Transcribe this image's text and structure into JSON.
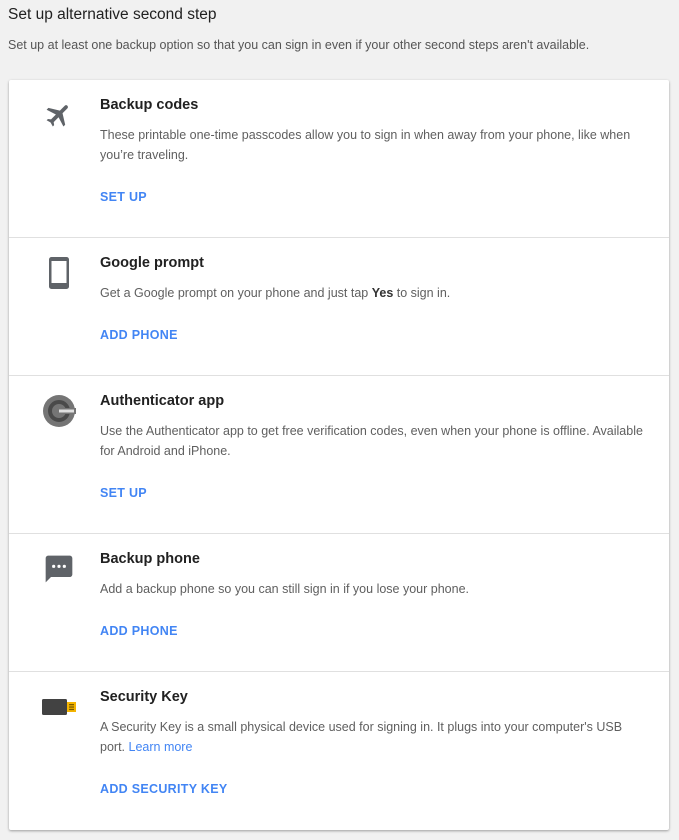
{
  "header": {
    "title": "Set up alternative second step",
    "subtitle": "Set up at least one backup option so that you can sign in even if your other second steps aren't available."
  },
  "options": [
    {
      "icon": "airplane-icon",
      "title": "Backup codes",
      "description": "These printable one-time passcodes allow you to sign in when away from your phone, like when you’re traveling.",
      "action": "SET UP"
    },
    {
      "icon": "phone-icon",
      "title": "Google prompt",
      "description_before": "Get a Google prompt on your phone and just tap ",
      "description_bold": "Yes",
      "description_after": " to sign in.",
      "action": "ADD PHONE"
    },
    {
      "icon": "authenticator-icon",
      "title": "Authenticator app",
      "description": "Use the Authenticator app to get free verification codes, even when your phone is offline. Available for Android and iPhone.",
      "action": "SET UP"
    },
    {
      "icon": "message-icon",
      "title": "Backup phone",
      "description": "Add a backup phone so you can still sign in if you lose your phone.",
      "action": "ADD PHONE"
    },
    {
      "icon": "usb-key-icon",
      "title": "Security Key",
      "description": "A Security Key is a small physical device used for signing in. It plugs into your computer's USB port.",
      "link": "Learn more",
      "action": "ADD SECURITY KEY"
    }
  ],
  "colors": {
    "link": "#4285f4",
    "icon": "#5f6368",
    "usb_gold": "#f4b400"
  }
}
